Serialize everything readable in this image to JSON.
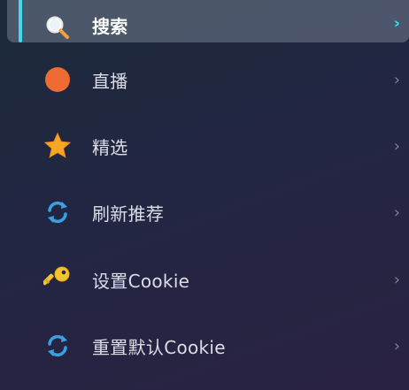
{
  "colors": {
    "accent": "#41d9ef",
    "live_dot": "#f06a34",
    "star": "#f5a623",
    "refresh": "#3aa0e0",
    "key": "#f4c430"
  },
  "menu": {
    "items": [
      {
        "label": "搜索",
        "icon": "search-icon",
        "active": true,
        "chevron": "›"
      },
      {
        "label": "直播",
        "icon": "live-dot-icon",
        "active": false,
        "chevron": "›"
      },
      {
        "label": "精选",
        "icon": "star-icon",
        "active": false,
        "chevron": "›"
      },
      {
        "label": "刷新推荐",
        "icon": "refresh-icon",
        "active": false,
        "chevron": "›"
      },
      {
        "label": "设置Cookie",
        "icon": "key-icon",
        "active": false,
        "chevron": "›"
      },
      {
        "label": "重置默认Cookie",
        "icon": "refresh-icon",
        "active": false,
        "chevron": "›"
      }
    ]
  }
}
